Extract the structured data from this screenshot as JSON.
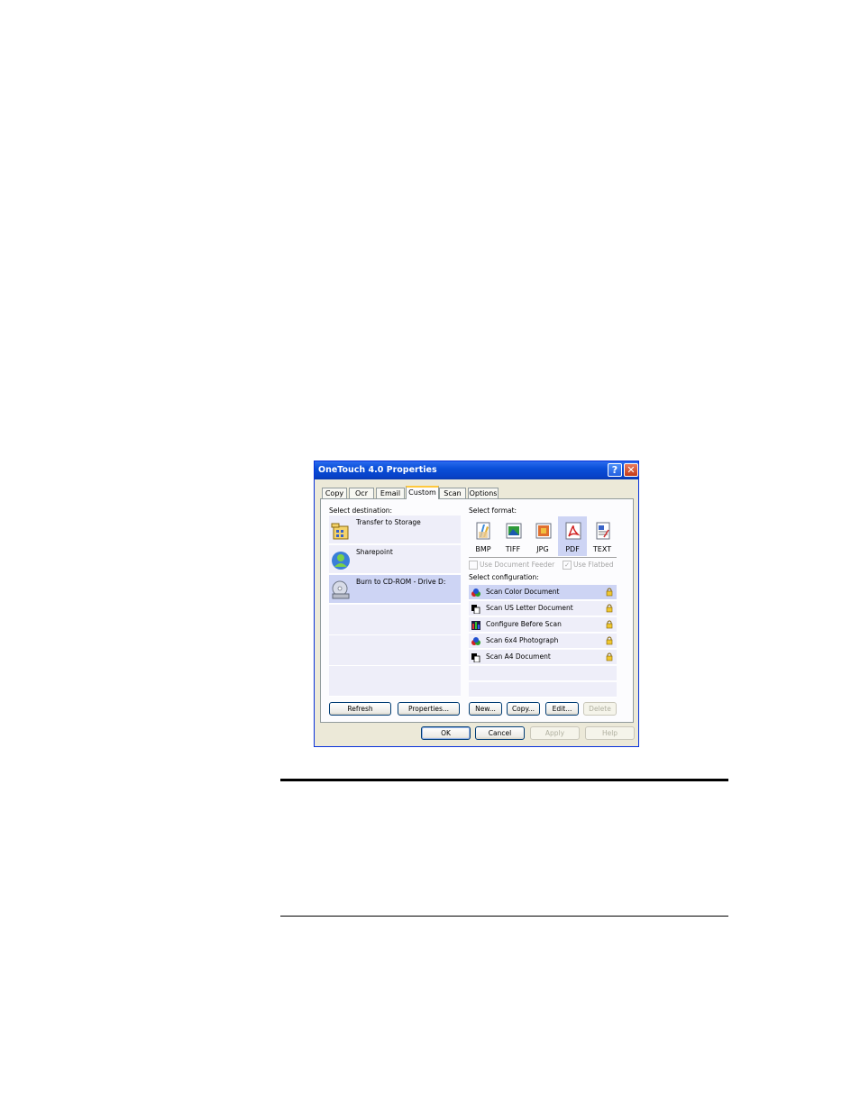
{
  "dialog": {
    "title": "OneTouch 4.0 Properties",
    "help_glyph": "?",
    "close_glyph": "✕"
  },
  "tabs": [
    {
      "label": "Copy"
    },
    {
      "label": "Ocr"
    },
    {
      "label": "Email"
    },
    {
      "label": "Custom",
      "selected": true
    },
    {
      "label": "Scan"
    },
    {
      "label": "Options"
    }
  ],
  "destination": {
    "label": "Select destination:",
    "items": [
      {
        "label": "Transfer to Storage",
        "icon": "storage-icon"
      },
      {
        "label": "Sharepoint",
        "icon": "sharepoint-icon"
      },
      {
        "label": "Burn to CD-ROM - Drive D:",
        "icon": "cd-rom-icon",
        "selected": true
      }
    ],
    "refresh_label": "Refresh",
    "properties_label": "Properties..."
  },
  "format": {
    "label": "Select format:",
    "items": [
      {
        "label": "BMP",
        "icon": "bmp-icon"
      },
      {
        "label": "TIFF",
        "icon": "tiff-icon"
      },
      {
        "label": "JPG",
        "icon": "jpg-icon"
      },
      {
        "label": "PDF",
        "icon": "pdf-icon",
        "selected": true
      },
      {
        "label": "TEXT",
        "icon": "text-icon"
      }
    ],
    "use_document_feeder": "Use Document Feeder",
    "use_flatbed": "Use Flatbed"
  },
  "configuration": {
    "label": "Select configuration:",
    "items": [
      {
        "label": "Scan Color Document",
        "icon": "color-document-icon",
        "selected": true
      },
      {
        "label": "Scan US Letter Document",
        "icon": "bw-document-icon"
      },
      {
        "label": "Configure Before Scan",
        "icon": "configure-icon"
      },
      {
        "label": "Scan 6x4 Photograph",
        "icon": "color-document-icon"
      },
      {
        "label": "Scan A4 Document",
        "icon": "bw-document-icon"
      }
    ],
    "new_label": "New...",
    "copy_label": "Copy...",
    "edit_label": "Edit...",
    "delete_label": "Delete"
  },
  "footer": {
    "ok_label": "OK",
    "cancel_label": "Cancel",
    "apply_label": "Apply",
    "help_label": "Help"
  },
  "colors": {
    "titlebar": "#0a4fd8",
    "selection": "#cdd4f4",
    "list_bg": "#eeeef9",
    "dialog_bg": "#ece9d8"
  }
}
